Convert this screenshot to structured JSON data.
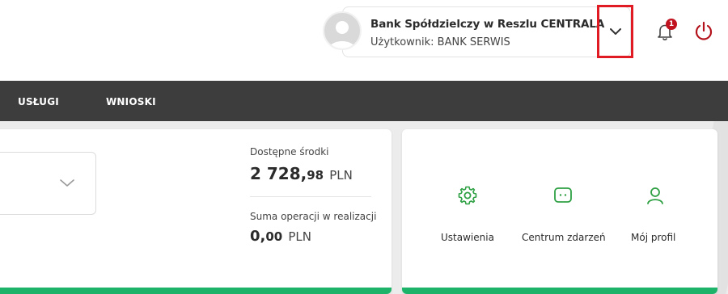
{
  "header": {
    "bank_name": "Bank Spółdzielczy w Reszlu CENTRALA",
    "user_line": "Użytkownik: BANK SERWIS",
    "notification_count": "1"
  },
  "nav": {
    "items": [
      {
        "label": "USŁUGI"
      },
      {
        "label": "WNIOSKI"
      }
    ]
  },
  "account": {
    "available_label": "Dostępne środki",
    "available_int": "2 728,",
    "available_dec": "98",
    "available_currency": "PLN",
    "pending_label": "Suma operacji w realizacji",
    "pending_int": "0,",
    "pending_dec": "00",
    "pending_currency": "PLN"
  },
  "quick_links": [
    {
      "label": "Ustawienia",
      "icon": "gear-icon"
    },
    {
      "label": "Centrum zdarzeń",
      "icon": "message-icon"
    },
    {
      "label": "Mój profil",
      "icon": "user-icon"
    }
  ],
  "colors": {
    "accent_green": "#1db46a",
    "icon_green": "#2ea043",
    "nav_bg": "#3d3d3d",
    "highlight_red": "#e01b24",
    "power_red": "#b3121b"
  }
}
